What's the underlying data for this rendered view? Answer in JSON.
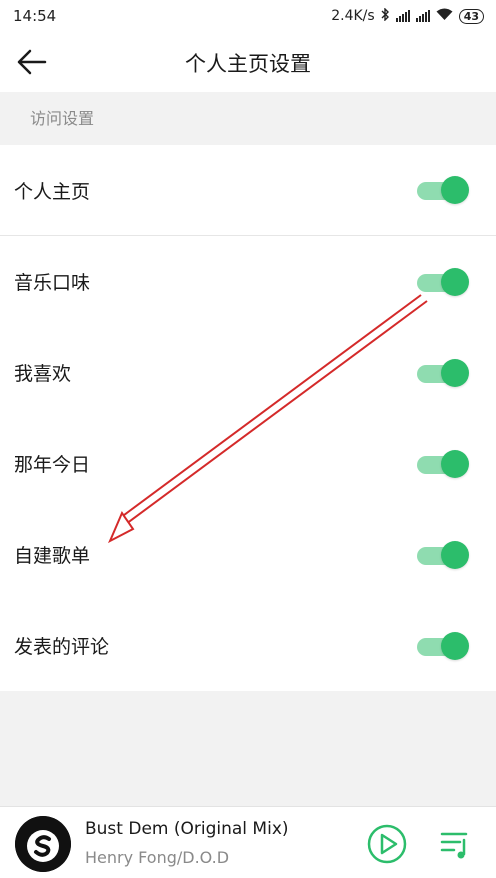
{
  "status_bar": {
    "time": "14:54",
    "speed": "2.4K/s",
    "battery": "43",
    "icons": [
      "bluetooth-icon",
      "signal-icon",
      "signal-icon",
      "wifi-icon",
      "battery-icon"
    ]
  },
  "header": {
    "title": "个人主页设置",
    "back_icon": "arrow-left-icon"
  },
  "section": {
    "label": "访问设置"
  },
  "settings": [
    {
      "label": "个人主页",
      "enabled": true
    },
    {
      "label": "音乐口味",
      "enabled": true
    },
    {
      "label": "我喜欢",
      "enabled": true
    },
    {
      "label": "那年今日",
      "enabled": true
    },
    {
      "label": "自建歌单",
      "enabled": true
    },
    {
      "label": "发表的评论",
      "enabled": true
    }
  ],
  "player": {
    "title": "Bust Dem (Original Mix)",
    "artist": "Henry Fong/D.O.D",
    "play_icon": "play-icon",
    "playlist_icon": "playlist-icon"
  },
  "colors": {
    "accent": "#2cbd6b",
    "track": "#8fdcb0",
    "annotation_arrow": "#d42a2a"
  }
}
